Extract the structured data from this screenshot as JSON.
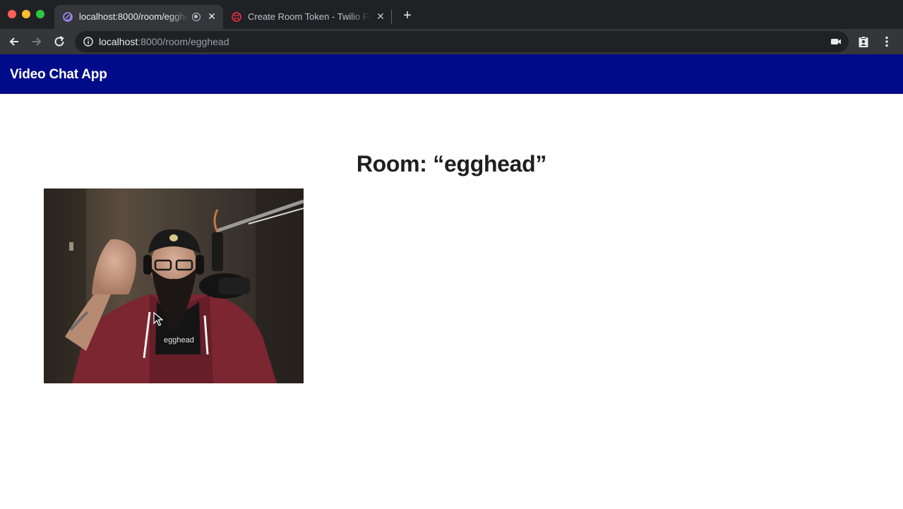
{
  "browser": {
    "tabs": [
      {
        "title": "localhost:8000/room/egghead",
        "active": true,
        "recording": true
      },
      {
        "title": "Create Room Token - Twilio Functions",
        "active": false
      }
    ],
    "new_tab_icon": "plus-icon",
    "address": {
      "host": "localhost",
      "path": ":8000/room/egghead"
    }
  },
  "app": {
    "header_title": "Video Chat App",
    "header_color": "#000b8a",
    "room_title": "Room: “egghead”"
  },
  "video": {
    "description_icon": "camera-feed",
    "shirt_text": "egghead"
  }
}
